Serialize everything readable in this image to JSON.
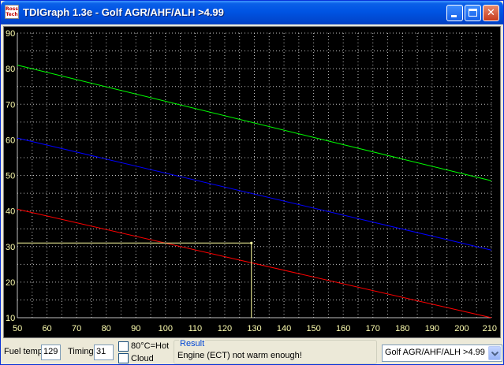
{
  "window": {
    "title": "TDIGraph 1.3e - Golf AGR/AHF/ALH >4.99",
    "app_icon_text_top": "Ross",
    "app_icon_text_bottom": "Tech"
  },
  "controls": {
    "fuel_temp_label": "Fuel temp",
    "fuel_temp_value": "129",
    "timing_label": "Timing",
    "timing_value": "31",
    "hot_checkbox_label": "80°C=Hot",
    "cloud_checkbox_label": "Cloud",
    "result_title": "Result",
    "result_message": "Engine (ECT) not warm enough!",
    "model_select_value": "Golf AGR/AHF/ALH >4.99"
  },
  "colors": {
    "plot_background": "#000000",
    "grid": "#c0c0c0",
    "tick_label": "#ffffb0",
    "upper_line": "#00ff00",
    "middle_line": "#0000ff",
    "lower_line": "#ff0000",
    "crosshair": "#ffffa0"
  },
  "chart_data": {
    "type": "line",
    "title": "",
    "xlabel": "",
    "ylabel": "",
    "xlim": [
      50,
      210
    ],
    "ylim": [
      10,
      90
    ],
    "x_ticks": [
      50,
      60,
      70,
      80,
      90,
      100,
      110,
      120,
      130,
      140,
      150,
      160,
      170,
      180,
      190,
      200,
      210
    ],
    "y_ticks": [
      10,
      20,
      30,
      40,
      50,
      60,
      70,
      80,
      90
    ],
    "grid": true,
    "grid_style": "dotted",
    "x_minor_step": 5,
    "y_minor_step": 5,
    "series": [
      {
        "color": "#00ff00",
        "x": [
          50,
          210
        ],
        "values": [
          81,
          48.5
        ]
      },
      {
        "color": "#0000ff",
        "x": [
          50,
          210
        ],
        "values": [
          60.5,
          29
        ]
      },
      {
        "color": "#ff0000",
        "x": [
          50,
          210
        ],
        "values": [
          40.5,
          10
        ]
      }
    ],
    "marker": {
      "x": 129,
      "y": 31,
      "color": "#ffffa0"
    }
  }
}
